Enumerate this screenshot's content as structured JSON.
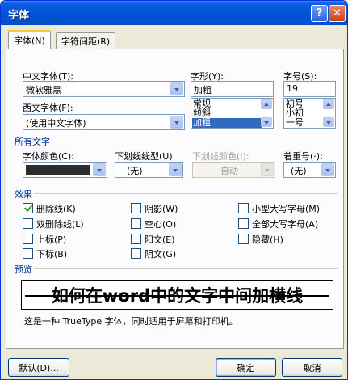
{
  "window": {
    "title": "字体",
    "help_label": "?",
    "close_label": "✕"
  },
  "tabs": [
    {
      "label": "字体(N)",
      "active": true
    },
    {
      "label": "字符间距(R)",
      "active": false
    }
  ],
  "font": {
    "cn_font_label": "中文字体(T):",
    "cn_font_value": "微软雅黑",
    "west_font_label": "西文字体(F):",
    "west_font_value": "(使用中文字体)",
    "style_label": "字形(Y):",
    "style_value": "加粗",
    "style_options": [
      "常规",
      "倾斜",
      "加粗"
    ],
    "style_selected": "加粗",
    "size_label": "字号(S):",
    "size_value": "19",
    "size_options": [
      "初号",
      "小初",
      "一号"
    ]
  },
  "all_text": {
    "section_label": "所有文字",
    "color_label": "字体颜色(C):",
    "color_value": "#2b2b2b",
    "underline_label": "下划线线型(U):",
    "underline_value": "(无)",
    "underline_color_label": "下划线颜色(I):",
    "underline_color_value": "自动",
    "emphasis_label": "着重号(·):",
    "emphasis_value": "(无)"
  },
  "effects": {
    "section_label": "效果",
    "items": [
      {
        "label": "删除线(K)",
        "checked": true
      },
      {
        "label": "双删除线(L)",
        "checked": false
      },
      {
        "label": "上标(P)",
        "checked": false
      },
      {
        "label": "下标(B)",
        "checked": false
      },
      {
        "label": "阴影(W)",
        "checked": false
      },
      {
        "label": "空心(O)",
        "checked": false
      },
      {
        "label": "阳文(E)",
        "checked": false
      },
      {
        "label": "阴文(G)",
        "checked": false
      },
      {
        "label": "小型大写字母(M)",
        "checked": false
      },
      {
        "label": "全部大写字母(A)",
        "checked": false
      },
      {
        "label": "隐藏(H)",
        "checked": false
      }
    ]
  },
  "preview": {
    "section_label": "预览",
    "text": "如何在word中的文字中间加横线",
    "note": "这是一种 TrueType 字体，同时适用于屏幕和打印机。"
  },
  "buttons": {
    "default": "默认(D)...",
    "ok": "确定",
    "cancel": "取消"
  }
}
